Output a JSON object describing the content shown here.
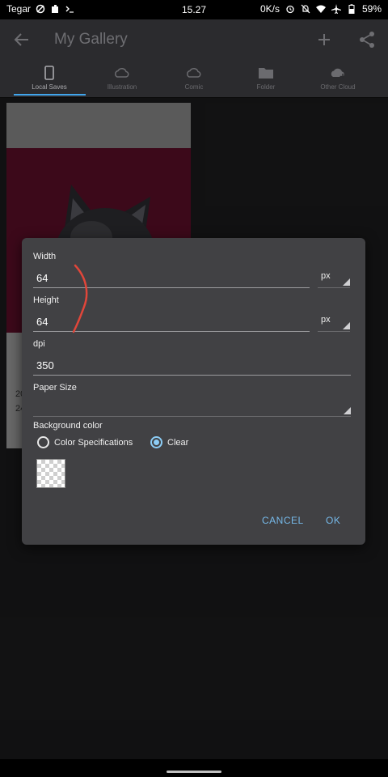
{
  "status_bar": {
    "carrier": "Tegar",
    "time": "15.27",
    "network_speed": "0K/s",
    "battery": "59%"
  },
  "app_bar": {
    "title": "My Gallery",
    "icons": [
      "back-arrow-icon",
      "add-icon",
      "share-icon"
    ]
  },
  "tabs": [
    {
      "label": "Local Saves",
      "icon": "phone-icon",
      "active": true
    },
    {
      "label": "Illustration",
      "icon": "cloud-icon",
      "active": false
    },
    {
      "label": "Comic",
      "icon": "cloud-icon",
      "active": false
    },
    {
      "label": "Folder",
      "icon": "folder-icon",
      "active": false
    },
    {
      "label": "Other Cloud",
      "icon": "cloud-add-icon",
      "active": false
    }
  ],
  "gallery_card": {
    "date_line_1": "20",
    "date_line_2": "24"
  },
  "dialog": {
    "width_label": "Width",
    "width_value": "64",
    "width_unit": "px",
    "height_label": "Height",
    "height_value": "64",
    "height_unit": "px",
    "dpi_label": "dpi",
    "dpi_value": "350",
    "paper_size_label": "Paper Size",
    "paper_size_value": "",
    "background_label": "Background color",
    "radio_options": [
      {
        "label": "Color Specifications",
        "selected": false
      },
      {
        "label": "Clear",
        "selected": true
      }
    ],
    "cancel_label": "CANCEL",
    "ok_label": "OK"
  },
  "colors": {
    "accent": "#41a5ec",
    "dialog_bg": "#414144",
    "artwork_bg": "#5c0f28",
    "scribble": "#e0463a"
  }
}
